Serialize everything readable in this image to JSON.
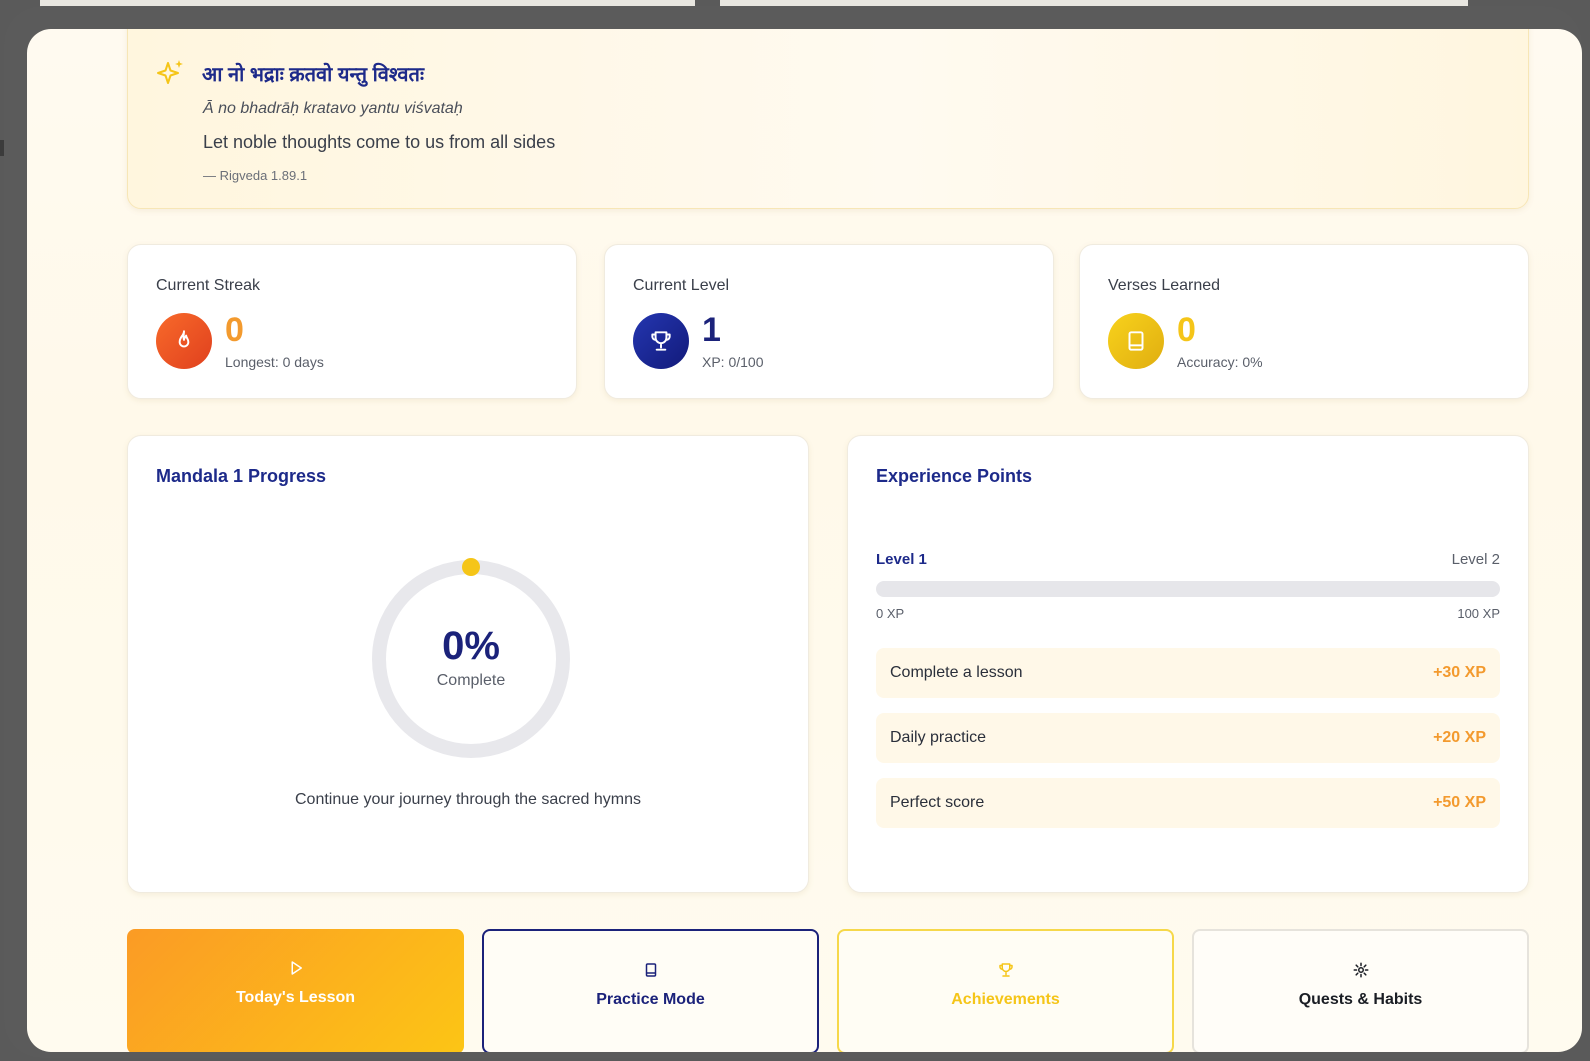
{
  "quote": {
    "sanskrit": "आ नो भद्राः क्रतवो यन्तु विश्वतः",
    "transliteration": "Ā no bhadrāḥ kratavo yantu viśvataḥ",
    "meaning": "Let noble thoughts come to us from all sides",
    "source": "— Rigveda 1.89.1",
    "icon": "sparkles-icon"
  },
  "stats": {
    "streak": {
      "label": "Current Streak",
      "value": "0",
      "sub": "Longest: 0 days",
      "icon": "flame-icon",
      "color": "#f39a2e"
    },
    "level": {
      "label": "Current Level",
      "value": "1",
      "sub": "XP: 0/100",
      "icon": "trophy-icon",
      "color": "#1b227a"
    },
    "verses": {
      "label": "Verses Learned",
      "value": "0",
      "sub": "Accuracy: 0%",
      "icon": "book-icon",
      "color": "#f5c518"
    }
  },
  "progress": {
    "title": "Mandala 1 Progress",
    "percent_label": "0%",
    "complete_label": "Complete",
    "fraction": 0,
    "caption": "Continue your journey through the sacred hymns"
  },
  "experience": {
    "title": "Experience Points",
    "level_current": "Level 1",
    "level_next": "Level 2",
    "xp_min": "0 XP",
    "xp_max": "100 XP",
    "fraction": 0,
    "rewards": [
      {
        "label": "Complete a lesson",
        "points": "+30 XP"
      },
      {
        "label": "Daily practice",
        "points": "+20 XP"
      },
      {
        "label": "Perfect score",
        "points": "+50 XP"
      }
    ]
  },
  "actions": [
    {
      "label": "Today's Lesson",
      "icon": "play-icon"
    },
    {
      "label": "Practice Mode",
      "icon": "book-icon"
    },
    {
      "label": "Achievements",
      "icon": "trophy-icon"
    },
    {
      "label": "Quests & Habits",
      "icon": "gear-icon"
    }
  ],
  "colors": {
    "accent_orange": "#f39a2e",
    "navy": "#1b227a",
    "gold": "#f5c518"
  }
}
